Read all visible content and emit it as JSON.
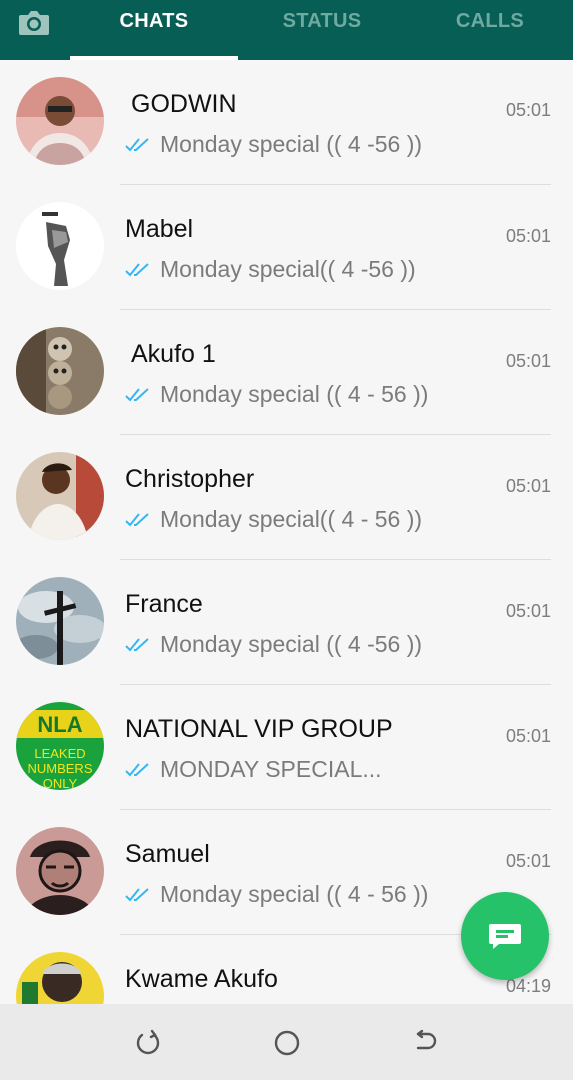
{
  "header": {
    "camera_icon": "camera-icon",
    "tabs": [
      {
        "label": "CHATS",
        "active": true
      },
      {
        "label": "STATUS",
        "active": false
      },
      {
        "label": "CALLS",
        "active": false
      }
    ],
    "bar_color": "#075e54"
  },
  "chats": [
    {
      "name": "GODWIN",
      "time": "05:01",
      "preview": "Monday special (( 4 -56  ))"
    },
    {
      "name": "Mabel",
      "time": "05:01",
      "preview": "Monday special(( 4 -56  ))"
    },
    {
      "name": "Akufo 1",
      "time": "05:01",
      "preview": "Monday special (( 4 - 56 ))"
    },
    {
      "name": "Christopher",
      "time": "05:01",
      "preview": "Monday special(( 4 - 56 ))"
    },
    {
      "name": "France",
      "time": "05:01",
      "preview": "Monday special (( 4 -56  ))"
    },
    {
      "name": "NATIONAL VIP GROUP",
      "time": "05:01",
      "preview": "MONDAY SPECIAL...",
      "avatar_text": [
        "NLA",
        "LEAKED",
        "NUMBERS",
        "ONLY"
      ]
    },
    {
      "name": "Samuel",
      "time": "05:01",
      "preview": "Monday special (( 4 - 56 ))"
    },
    {
      "name": "Kwame Akufo",
      "time": "04:19",
      "preview": ""
    }
  ],
  "fab": {
    "icon": "new-chat-icon",
    "color": "#25c26a"
  },
  "nav": {
    "icons": [
      "recent-apps-icon",
      "home-icon",
      "back-icon"
    ]
  },
  "tick_color": "#34b7f1"
}
